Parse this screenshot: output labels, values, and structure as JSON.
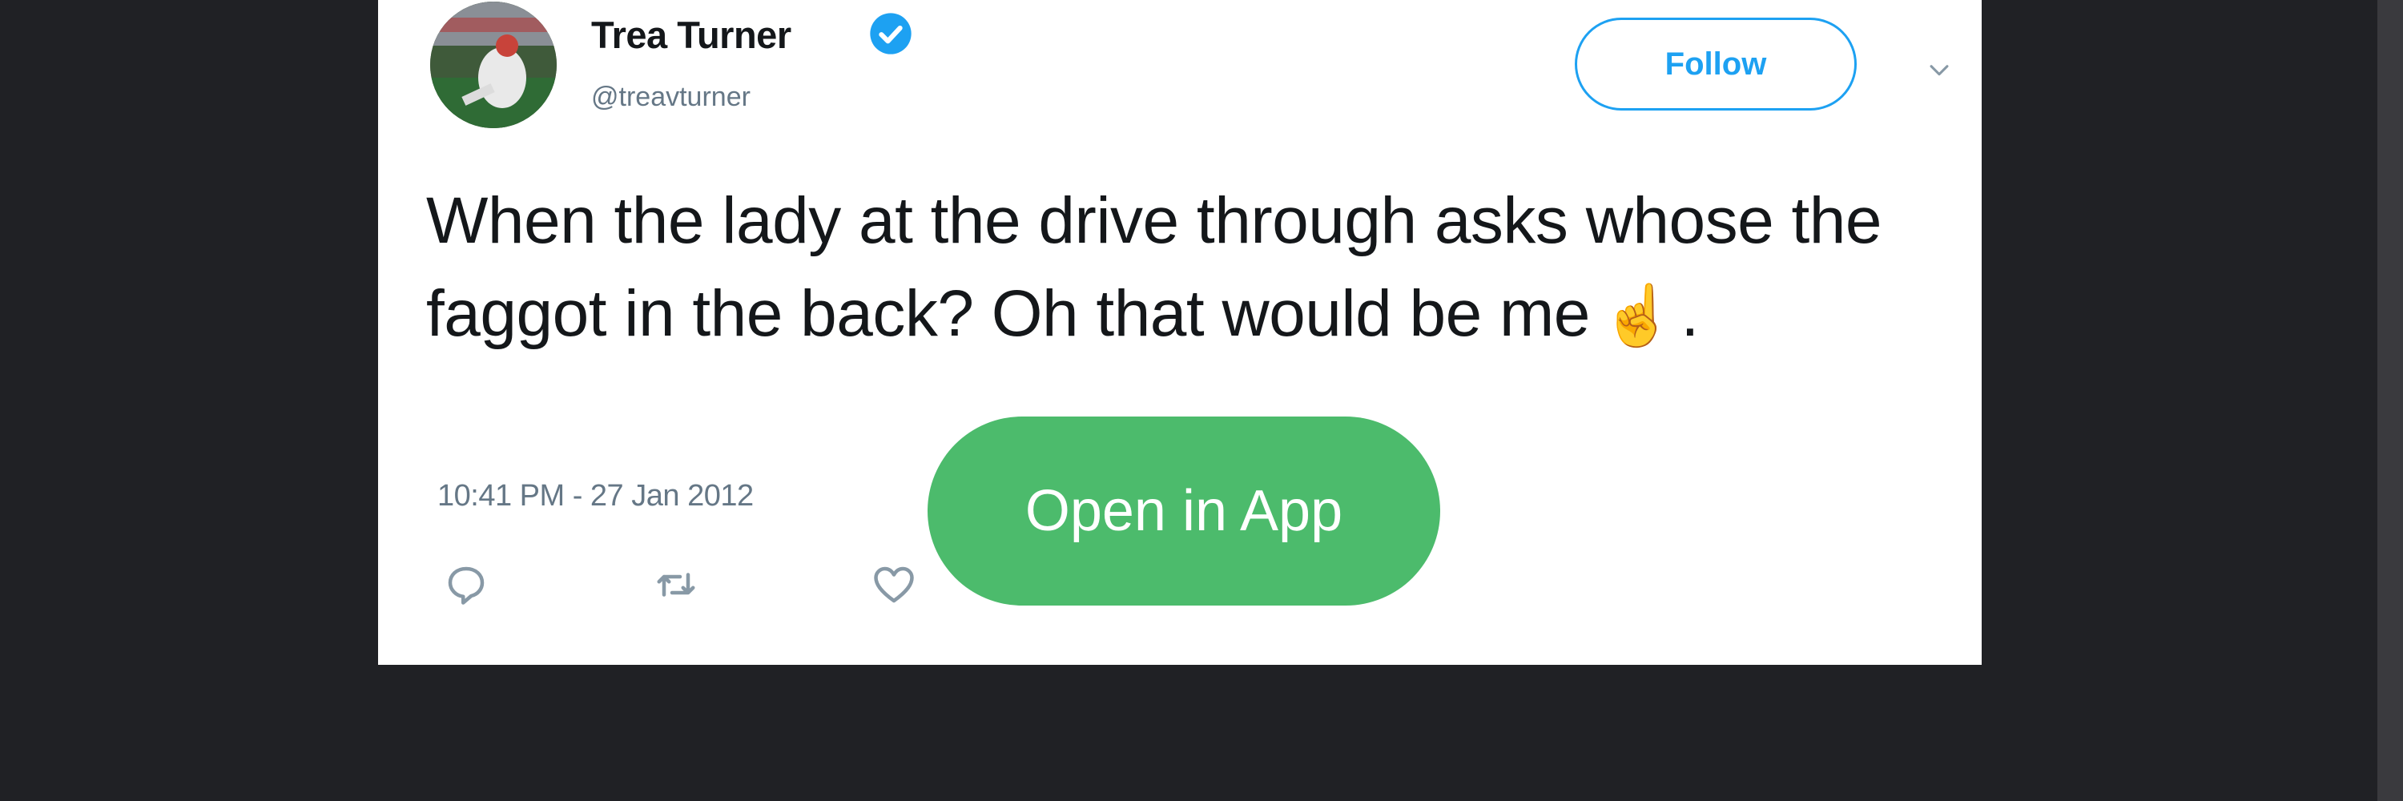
{
  "tweet": {
    "author": {
      "display_name": "Trea Turner",
      "handle": "@treavturner",
      "verified": true,
      "verified_color": "#1da1f2"
    },
    "follow_label": "Follow",
    "text_before_emoji": "When the lady at the drive through asks whose the faggot in the back? Oh that would be me",
    "emoji": "☝",
    "text_after_emoji": ".",
    "timestamp": "10:41 PM - 27 Jan 2012",
    "actions": [
      "reply-icon",
      "retweet-icon",
      "like-icon"
    ],
    "accent_color": "#1da1f2"
  },
  "overlay": {
    "open_in_app_label": "Open in App",
    "button_color": "#4cbb6c"
  }
}
